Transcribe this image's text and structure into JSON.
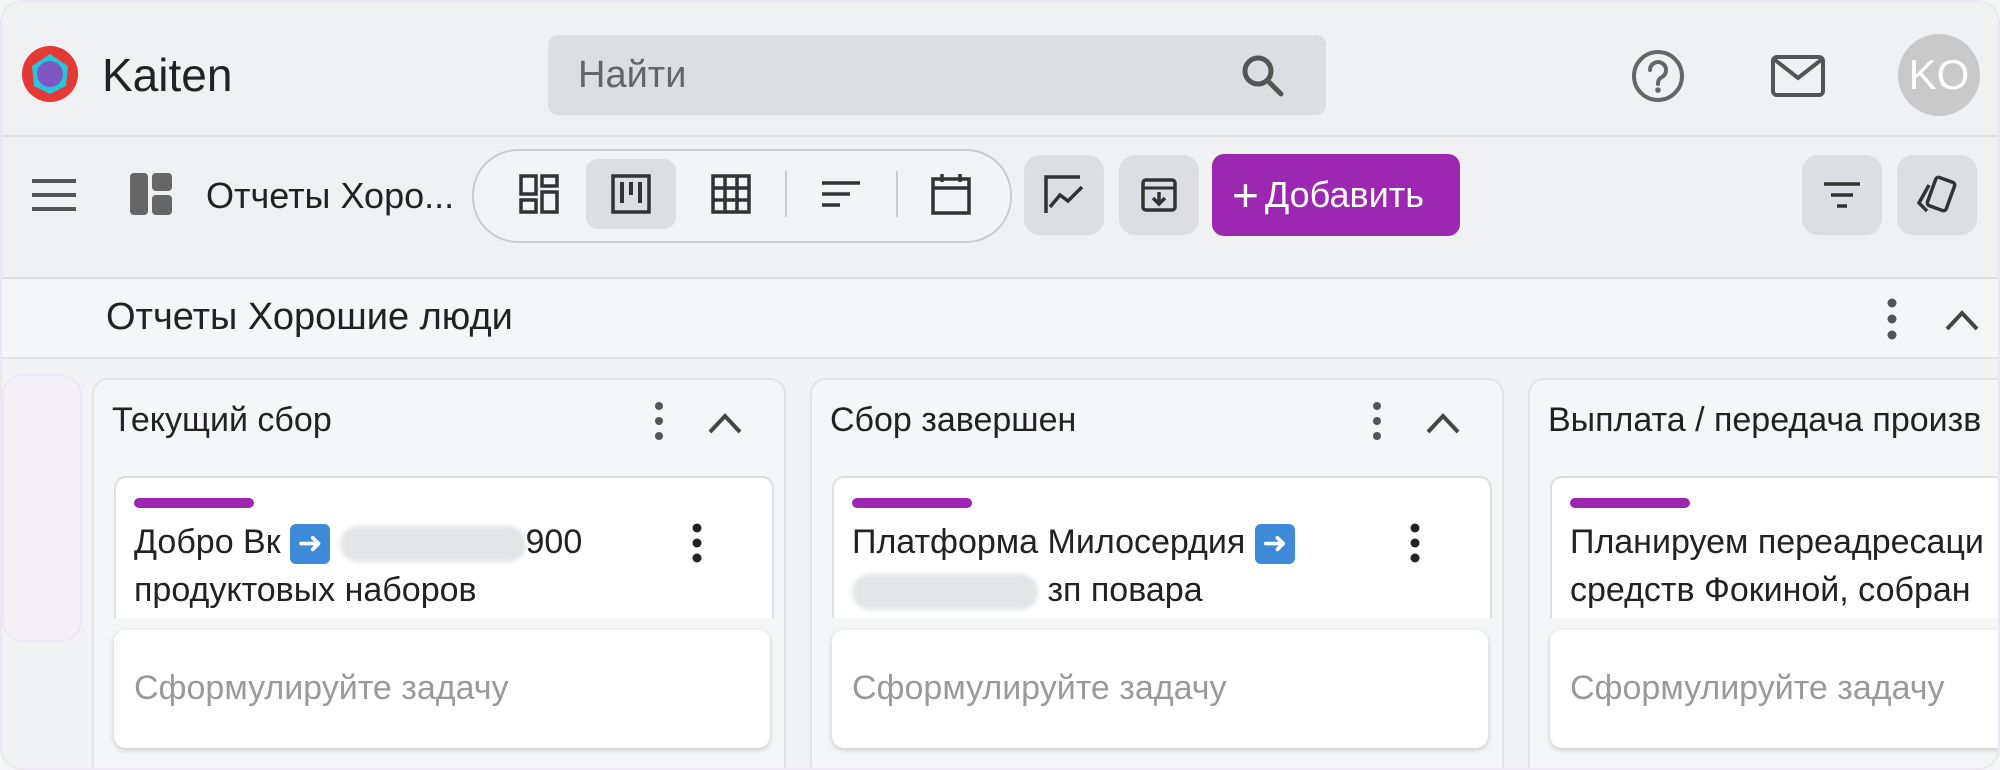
{
  "header": {
    "brand": "Kaiten",
    "search_placeholder": "Найти",
    "avatar_initials": "KO",
    "icons": [
      "kaiten-logo-icon",
      "search-icon",
      "help-icon",
      "mail-icon"
    ]
  },
  "toolbar": {
    "board_title": "Отчеты Хоро...",
    "add_label": "Добавить",
    "accent_color": "#9c27b0",
    "views": [
      "dashboard-view-icon",
      "kanban-view-icon",
      "table-view-icon",
      "list-view-icon",
      "calendar-view-icon"
    ],
    "active_view": "kanban"
  },
  "board": {
    "title": "Отчеты Хорошие люди"
  },
  "columns": [
    {
      "title": "Текущий сбор",
      "card": {
        "text_a": "Добро Вк",
        "text_b": "900",
        "text_c": "продуктовых наборов"
      },
      "task_placeholder": "Сформулируйте задачу"
    },
    {
      "title": "Сбор завершен",
      "card": {
        "text_a": "Платформа Милосердия",
        "text_b": "зп повара"
      },
      "task_placeholder": "Сформулируйте задачу"
    },
    {
      "title": "Выплата / передача произв",
      "card": {
        "text_a": "Планируем переадресаци",
        "text_b": "средств Фокиной, собран"
      },
      "task_placeholder": "Сформулируйте задачу"
    }
  ]
}
